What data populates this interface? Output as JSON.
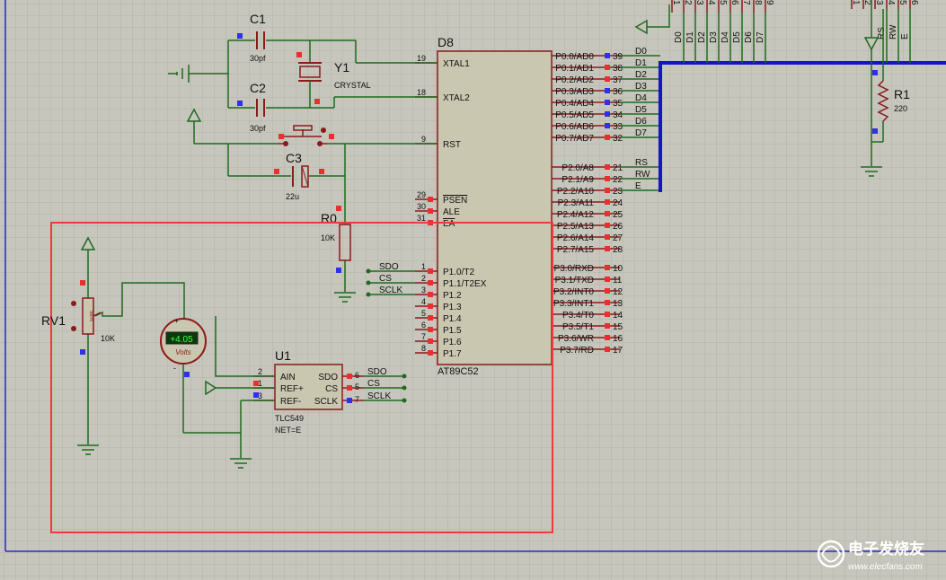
{
  "colors": {
    "background": "#c6c6bc",
    "grid": "#b4b4aa",
    "wire": "#1f6a1f",
    "component": "#8b1a1a",
    "chip_fill": "#c9c7b0",
    "bus": "#1515c8",
    "selection": "#ee3a3a",
    "pin_red": "#e83030",
    "pin_blue": "#3030e8",
    "text": "#111111"
  },
  "mcu": {
    "ref": "D8",
    "part": "AT89C52",
    "left_pins": [
      {
        "num": "19",
        "name": "XTAL1"
      },
      {
        "num": "18",
        "name": "XTAL2"
      },
      {
        "num": "9",
        "name": "RST"
      },
      {
        "num": "29",
        "name": "PSEN"
      },
      {
        "num": "30",
        "name": "ALE"
      },
      {
        "num": "31",
        "name": "EA"
      },
      {
        "num": "1",
        "name": "P1.0/T2"
      },
      {
        "num": "2",
        "name": "P1.1/T2EX"
      },
      {
        "num": "3",
        "name": "P1.2"
      },
      {
        "num": "4",
        "name": "P1.3"
      },
      {
        "num": "5",
        "name": "P1.4"
      },
      {
        "num": "6",
        "name": "P1.5"
      },
      {
        "num": "7",
        "name": "P1.6"
      },
      {
        "num": "8",
        "name": "P1.7"
      }
    ],
    "right_pins": [
      {
        "num": "39",
        "name": "P0.0/AD0",
        "net": "D0"
      },
      {
        "num": "38",
        "name": "P0.1/AD1",
        "net": "D1"
      },
      {
        "num": "37",
        "name": "P0.2/AD2",
        "net": "D2"
      },
      {
        "num": "36",
        "name": "P0.3/AD3",
        "net": "D3"
      },
      {
        "num": "35",
        "name": "P0.4/AD4",
        "net": "D4"
      },
      {
        "num": "34",
        "name": "P0.5/AD5",
        "net": "D5"
      },
      {
        "num": "33",
        "name": "P0.6/AD6",
        "net": "D6"
      },
      {
        "num": "32",
        "name": "P0.7/AD7",
        "net": "D7"
      },
      {
        "num": "21",
        "name": "P2.0/A8",
        "net": "RS"
      },
      {
        "num": "22",
        "name": "P2.1/A9",
        "net": "RW"
      },
      {
        "num": "23",
        "name": "P2.2/A10",
        "net": "E"
      },
      {
        "num": "24",
        "name": "P2.3/A11",
        "net": ""
      },
      {
        "num": "25",
        "name": "P2.4/A12",
        "net": ""
      },
      {
        "num": "26",
        "name": "P2.5/A13",
        "net": ""
      },
      {
        "num": "27",
        "name": "P2.6/A14",
        "net": ""
      },
      {
        "num": "28",
        "name": "P2.7/A15",
        "net": ""
      },
      {
        "num": "10",
        "name": "P3.0/RXD",
        "net": ""
      },
      {
        "num": "11",
        "name": "P3.1/TXD",
        "net": ""
      },
      {
        "num": "12",
        "name": "P3.2/INT0",
        "net": ""
      },
      {
        "num": "13",
        "name": "P3.3/INT1",
        "net": ""
      },
      {
        "num": "14",
        "name": "P3.4/T0",
        "net": ""
      },
      {
        "num": "15",
        "name": "P3.5/T1",
        "net": ""
      },
      {
        "num": "16",
        "name": "P3.6/WR",
        "net": ""
      },
      {
        "num": "17",
        "name": "P3.7/RD",
        "net": ""
      }
    ],
    "p1_nets": [
      "SDO",
      "CS",
      "SCLK"
    ]
  },
  "crystal": {
    "ref": "Y1",
    "value": "CRYSTAL"
  },
  "c1": {
    "ref": "C1",
    "value": "30pf"
  },
  "c2": {
    "ref": "C2",
    "value": "30pf"
  },
  "c3": {
    "ref": "C3",
    "value": "22u"
  },
  "r0": {
    "ref": "R0",
    "value": "10K"
  },
  "r1": {
    "ref": "R1",
    "value": "220"
  },
  "rv1": {
    "ref": "RV1",
    "value": "10K",
    "body_label": "58%"
  },
  "voltmeter": {
    "reading": "+4.05",
    "unit": "Volts",
    "plus": "+",
    "minus": "-"
  },
  "adc": {
    "ref": "U1",
    "part": "TLC549",
    "net_label": "NET=E",
    "left_pins": [
      {
        "num": "2",
        "name": "AIN"
      },
      {
        "num": "1",
        "name": "REF+"
      },
      {
        "num": "3",
        "name": "REF-"
      }
    ],
    "right_pins": [
      {
        "num": "6",
        "name": "SDO"
      },
      {
        "num": "5",
        "name": "CS"
      },
      {
        "num": "7",
        "name": "SCLK"
      }
    ]
  },
  "lcd_header": {
    "pins": [
      "1",
      "2",
      "3",
      "4",
      "5",
      "6",
      "7",
      "8",
      "9"
    ],
    "nets": [
      "D0",
      "D1",
      "D2",
      "D3",
      "D4",
      "D5",
      "D6",
      "D7"
    ]
  },
  "lcd_ctrl": {
    "pins": [
      "1",
      "2",
      "3",
      "4",
      "5",
      "6"
    ],
    "nets": [
      "RS",
      "RW",
      "E"
    ]
  },
  "watermark": {
    "brand": "电子发烧友",
    "url": "www.elecfans.com"
  }
}
